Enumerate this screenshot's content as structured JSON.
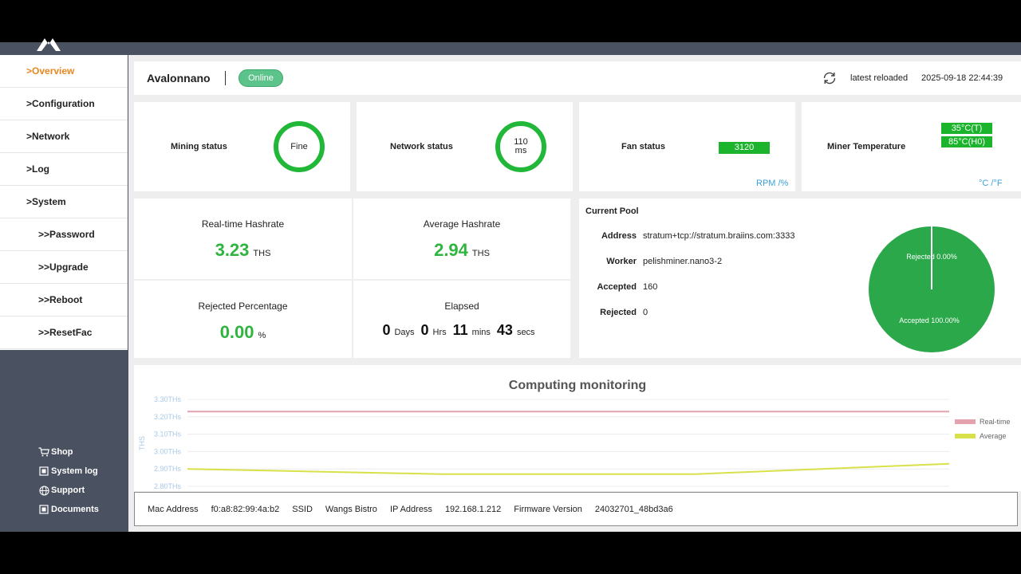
{
  "sidebar": {
    "menu": [
      {
        "label": ">Overview",
        "active": true
      },
      {
        "label": ">Configuration"
      },
      {
        "label": ">Network"
      },
      {
        "label": ">Log"
      },
      {
        "label": ">System"
      },
      {
        "label": ">>Password"
      },
      {
        "label": ">>Upgrade"
      },
      {
        "label": ">>Reboot"
      },
      {
        "label": ">>ResetFac"
      }
    ],
    "links": [
      {
        "label": "Shop",
        "icon": "cart-icon"
      },
      {
        "label": "System log",
        "icon": "log-icon"
      },
      {
        "label": "Support",
        "icon": "globe-icon"
      },
      {
        "label": "Documents",
        "icon": "document-icon"
      }
    ]
  },
  "header": {
    "device_name": "Avalonnano",
    "status": "Online",
    "reload_label": "latest reloaded",
    "reload_time": "2025-09-18 22:44:39"
  },
  "status_cards": {
    "mining": {
      "label": "Mining status",
      "value": "Fine"
    },
    "network": {
      "label": "Network status",
      "value": "110",
      "unit": "ms"
    },
    "fan": {
      "label": "Fan status",
      "value": "3120",
      "unit_toggle": "RPM /%"
    },
    "temperature": {
      "label": "Miner Temperature",
      "values": [
        "35°C(T)",
        "85°C(H0)"
      ],
      "unit_toggle": "°C /°F"
    }
  },
  "hashrate": {
    "realtime": {
      "title": "Real-time Hashrate",
      "value": "3.23",
      "unit": "THS"
    },
    "average": {
      "title": "Average Hashrate",
      "value": "2.94",
      "unit": "THS"
    },
    "rejected": {
      "title": "Rejected Percentage",
      "value": "0.00",
      "unit": "%"
    },
    "elapsed": {
      "title": "Elapsed",
      "days": "0",
      "days_unit": "Days",
      "hrs": "0",
      "hrs_unit": "Hrs",
      "mins": "11",
      "mins_unit": "mins",
      "secs": "43",
      "secs_unit": "secs"
    }
  },
  "pool": {
    "title": "Current Pool",
    "rows": [
      {
        "key": "Address",
        "value": "stratum+tcp://stratum.braiins.com:3333"
      },
      {
        "key": "Worker",
        "value": "pelishminer.nano3-2"
      },
      {
        "key": "Accepted",
        "value": "160"
      },
      {
        "key": "Rejected",
        "value": "0"
      }
    ],
    "pie_labels": {
      "rejected": "Rejected 0.00%",
      "accepted": "Accepted 100.00%"
    },
    "colors": {
      "accepted": "#2aa84a",
      "rejected": "#ffffff"
    }
  },
  "chart_data": {
    "type": "line",
    "title": "Computing monitoring",
    "ylabel": "THS",
    "ytick_labels": [
      "3.30THs",
      "3.20THs",
      "3.10THs",
      "3.00THs",
      "2.90THs",
      "2.80THs"
    ],
    "ylim": [
      2.8,
      3.3
    ],
    "grid": true,
    "legend": "right",
    "x": [
      0,
      1,
      2,
      3,
      4,
      5,
      6,
      7,
      8,
      9
    ],
    "series": [
      {
        "name": "Real-time",
        "color": "#e3a2ad",
        "values": [
          3.23,
          3.23,
          3.23,
          3.23,
          3.23,
          3.23,
          3.23,
          3.23,
          3.23,
          3.23
        ]
      },
      {
        "name": "Average",
        "color": "#d8e14a",
        "values": [
          2.9,
          2.89,
          2.88,
          2.87,
          2.87,
          2.87,
          2.87,
          2.89,
          2.91,
          2.93
        ]
      }
    ]
  },
  "footer": {
    "mac_label": "Mac Address",
    "mac": "f0:a8:82:99:4a:b2",
    "ssid_label": "SSID",
    "ssid": "Wangs Bistro",
    "ip_label": "IP Address",
    "ip": "192.168.1.212",
    "fw_label": "Firmware Version",
    "fw": "24032701_48bd3a6"
  }
}
